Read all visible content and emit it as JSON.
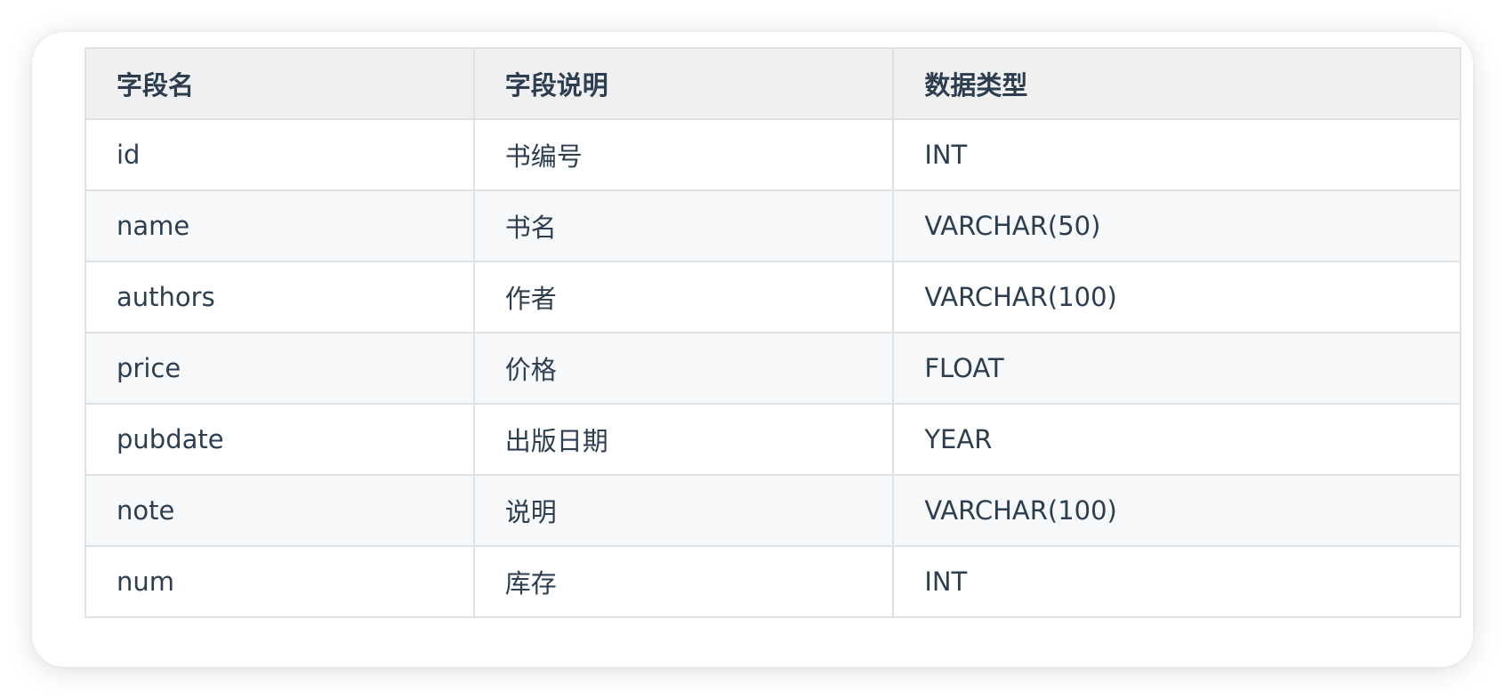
{
  "table": {
    "headers": [
      "字段名",
      "字段说明",
      "数据类型"
    ],
    "rows": [
      [
        "id",
        "书编号",
        "INT"
      ],
      [
        "name",
        "书名",
        "VARCHAR(50)"
      ],
      [
        "authors",
        "作者",
        "VARCHAR(100)"
      ],
      [
        "price",
        "价格",
        "FLOAT"
      ],
      [
        "pubdate",
        "出版日期",
        "YEAR"
      ],
      [
        "note",
        "说明",
        "VARCHAR(100)"
      ],
      [
        "num",
        "库存",
        "INT"
      ]
    ]
  },
  "colors": {
    "text": "#2c3e50",
    "border": "#dfe2e5",
    "header_bg": "#f0f0f0",
    "stripe_bg": "#f7f8f9"
  }
}
